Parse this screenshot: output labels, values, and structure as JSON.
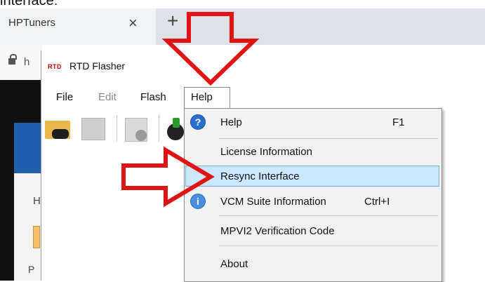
{
  "caption": "interface:",
  "browser": {
    "tab_title": "HPTuners",
    "tab_close": "×",
    "new_tab": "+",
    "address_partial": "h"
  },
  "background_window": {
    "letter_h": "H",
    "letter_p": "P"
  },
  "app": {
    "logo": "RTD",
    "title": "RTD Flasher"
  },
  "menubar": {
    "file": "File",
    "edit": "Edit",
    "flash": "Flash",
    "help": "Help"
  },
  "help_menu": {
    "items": [
      {
        "label": "Help",
        "shortcut": "F1",
        "icon": "help-icon"
      },
      {
        "label": "License Information"
      },
      {
        "label": "Resync Interface",
        "highlighted": true
      },
      {
        "label": "VCM Suite Information",
        "shortcut": "Ctrl+I",
        "icon": "info-icon"
      },
      {
        "label": "MPVI2 Verification Code"
      },
      {
        "label": "About"
      }
    ],
    "help_glyph": "?",
    "info_glyph": "i"
  },
  "colors": {
    "highlight": "#cce8ff",
    "arrow": "#e01414"
  }
}
